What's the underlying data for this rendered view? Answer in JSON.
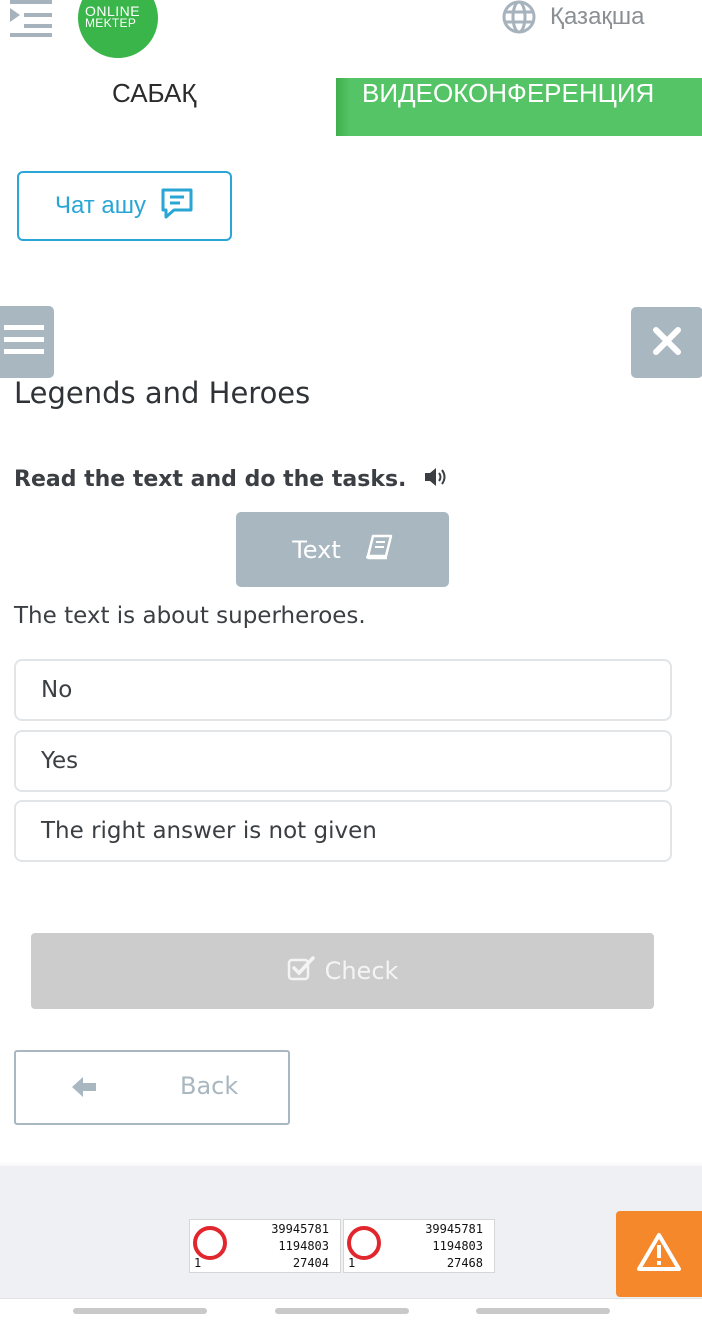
{
  "header": {
    "logo_line1": "ONLINE",
    "logo_line2": "MEKTEP",
    "language": "Қазақша"
  },
  "tabs": {
    "lesson": "САБАҚ",
    "videoconference": "ВИДЕОКОНФЕРЕНЦИЯ"
  },
  "chat": {
    "label": "Чат ашу"
  },
  "lesson": {
    "title": "Legends and Heroes",
    "instruction": "Read the text and do the tasks.",
    "text_button": "Text",
    "question": "The text is about superheroes.",
    "options": [
      "No",
      "Yes",
      "The right answer is not given"
    ],
    "check_button": "Check",
    "back_button": "Back"
  },
  "footer": {
    "counters": [
      {
        "top": "39945781",
        "mid": "1194803",
        "bottom": "27404",
        "corner": "1"
      },
      {
        "top": "39945781",
        "mid": "1194803",
        "bottom": "27468",
        "corner": "1"
      }
    ]
  },
  "colors": {
    "brand_green": "#39b54a",
    "tab_green": "#55c466",
    "chat_blue": "#2aa6d6",
    "slate": "#a9b7c1",
    "check_gray": "#cccccc",
    "warning_orange": "#f5882a"
  },
  "icons": {
    "menu": "indent-menu-icon",
    "language": "globe-icon",
    "chat": "chat-bubble-icon",
    "side_menu": "hamburger-icon",
    "close": "close-icon",
    "audio": "speaker-icon",
    "text": "book-icon",
    "check": "checkbox-icon",
    "back": "arrow-left-icon",
    "warning": "warning-triangle-icon"
  }
}
